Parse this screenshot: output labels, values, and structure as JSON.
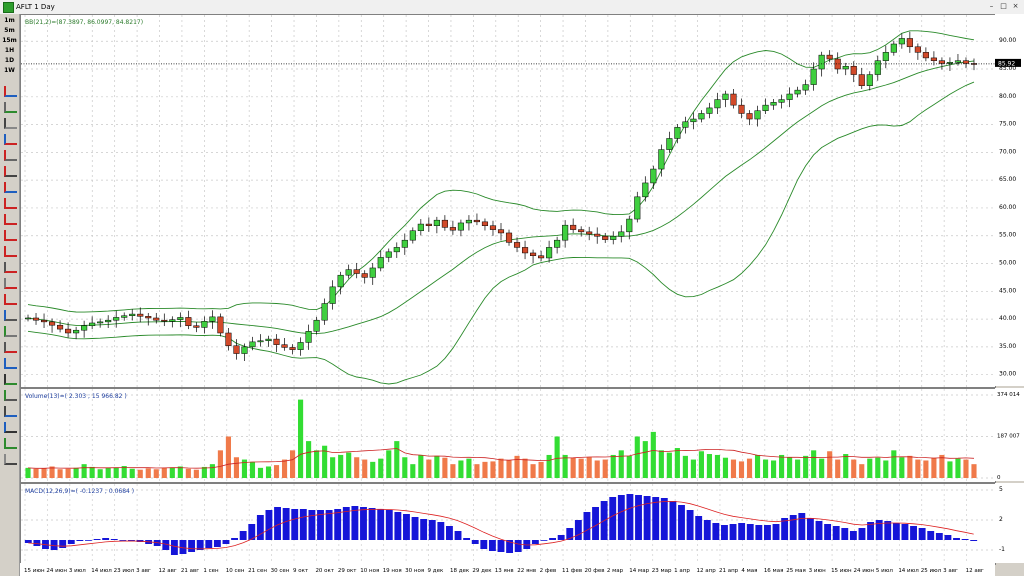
{
  "window": {
    "title": "AFLT 1 Day",
    "min_glyph": "–",
    "max_glyph": "□",
    "close_glyph": "×"
  },
  "timeframes": [
    "1m",
    "5m",
    "15m",
    "1H",
    "1D",
    "1W"
  ],
  "tools": [
    "cursor",
    "crosshair",
    "zoom-in",
    "zoom-out",
    "zoom-area",
    "line",
    "h-line",
    "v-line",
    "trend",
    "channel",
    "fib",
    "pencil",
    "text",
    "arrow",
    "ruler",
    "magnet",
    "delete",
    "lock",
    "layers",
    "grid",
    "settings",
    "bars",
    "candles",
    "volume"
  ],
  "price_panel": {
    "legend": "BB(21,2)=(87.3897, 86.0997, 84.8217)",
    "current_price_label": "85.92",
    "current_price": 85.92,
    "yticks": [
      "90.00",
      "85.00",
      "80.00",
      "75.00",
      "70.00",
      "65.00",
      "60.00",
      "55.00",
      "50.00",
      "45.00",
      "40.00",
      "35.00",
      "30.00"
    ]
  },
  "volume_panel": {
    "legend": "Volume(13)=( 2.303 ; 15 966.82 )",
    "yticks": [
      "374 014",
      "187 007",
      "0"
    ]
  },
  "macd_panel": {
    "legend": "MACD(12,26,9)=( -0.1237 ; 0.0684 )",
    "yticks": [
      "5",
      "2",
      "-1"
    ]
  },
  "x_labels": [
    "15 июн",
    "24 июн",
    "3 июл",
    "14 июл",
    "23 июл",
    "3 авг",
    "12 авг",
    "21 авг",
    "1 сен",
    "10 сен",
    "21 сен",
    "30 сен",
    "9 окт",
    "20 окт",
    "29 окт",
    "10 ноя",
    "19 ноя",
    "30 ноя",
    "9 дек",
    "18 дек",
    "29 дек",
    "13 янв",
    "22 янв",
    "2 фев",
    "11 фев",
    "20 фев",
    "2 мар",
    "14 мар",
    "23 мар",
    "1 апр",
    "12 апр",
    "21 апр",
    "4 мая",
    "16 мая",
    "25 мая",
    "3 июн",
    "15 июн",
    "24 июн",
    "5 июл",
    "14 июл",
    "25 июл",
    "3 авг",
    "12 авг"
  ],
  "chart_data": {
    "type": "candlestick",
    "close_series": [
      40.2,
      39.8,
      39.5,
      38.9,
      38.2,
      37.5,
      38.0,
      38.8,
      39.3,
      39.5,
      39.8,
      40.3,
      40.6,
      40.9,
      40.5,
      40.2,
      39.8,
      39.6,
      39.9,
      40.3,
      38.8,
      38.5,
      39.6,
      40.4,
      37.5,
      35.2,
      33.8,
      35.0,
      35.9,
      36.1,
      36.4,
      35.4,
      34.9,
      34.5,
      35.8,
      37.8,
      39.8,
      42.8,
      45.8,
      47.9,
      48.9,
      48.2,
      47.5,
      49.2,
      51.1,
      52.1,
      52.9,
      54.2,
      55.9,
      57.1,
      56.8,
      57.8,
      56.5,
      56.0,
      57.3,
      57.8,
      57.5,
      56.8,
      56.1,
      55.5,
      53.8,
      52.9,
      51.9,
      51.4,
      51.0,
      52.9,
      54.2,
      56.9,
      56.1,
      55.7,
      55.3,
      54.9,
      54.3,
      54.9,
      55.7,
      58.0,
      62.0,
      64.5,
      67.0,
      70.5,
      72.5,
      74.5,
      75.5,
      76.0,
      77.0,
      78.0,
      79.5,
      80.5,
      78.5,
      77.0,
      76.0,
      77.5,
      78.5,
      79.0,
      79.5,
      80.5,
      81.2,
      82.2,
      85.0,
      87.5,
      86.8,
      85.0,
      85.5,
      84.0,
      82.0,
      84.0,
      86.5,
      88.0,
      89.5,
      90.5,
      89.0,
      88.0,
      87.0,
      86.5,
      86.0,
      86.2,
      86.5,
      86.0,
      85.9
    ],
    "volume_series": [
      22,
      20,
      21,
      25,
      19,
      20,
      22,
      30,
      24,
      19,
      22,
      23,
      26,
      20,
      18,
      21,
      19,
      22,
      23,
      25,
      20,
      18,
      24,
      30,
      60,
      90,
      45,
      40,
      35,
      22,
      25,
      28,
      40,
      60,
      170,
      80,
      60,
      70,
      45,
      50,
      55,
      45,
      40,
      35,
      42,
      60,
      80,
      45,
      30,
      50,
      40,
      48,
      44,
      30,
      38,
      42,
      30,
      35,
      36,
      42,
      38,
      48,
      42,
      30,
      35,
      50,
      90,
      50,
      44,
      42,
      45,
      38,
      40,
      50,
      60,
      48,
      90,
      80,
      100,
      60,
      55,
      65,
      48,
      40,
      58,
      52,
      50,
      44,
      40,
      36,
      42,
      50,
      40,
      38,
      50,
      45,
      40,
      48,
      60,
      42,
      58,
      40,
      52,
      40,
      30,
      42,
      44,
      38,
      60,
      45,
      48,
      40,
      38,
      44,
      50,
      36,
      42,
      40,
      30
    ],
    "macd_series": [
      -0.3,
      -0.6,
      -0.9,
      -1.0,
      -0.8,
      -0.4,
      -0.1,
      0.0,
      0.1,
      0.2,
      0.1,
      0.0,
      -0.1,
      -0.2,
      -0.4,
      -0.6,
      -1.0,
      -1.5,
      -1.4,
      -1.2,
      -1.0,
      -0.8,
      -0.7,
      -0.4,
      0.2,
      0.9,
      1.6,
      2.5,
      3.0,
      3.3,
      3.2,
      3.1,
      3.1,
      3.0,
      3.0,
      3.0,
      3.1,
      3.3,
      3.4,
      3.3,
      3.2,
      3.1,
      3.0,
      2.8,
      2.6,
      2.3,
      2.1,
      2.0,
      1.8,
      1.4,
      0.9,
      0.2,
      -0.4,
      -0.9,
      -1.1,
      -1.2,
      -1.3,
      -1.2,
      -0.9,
      -0.4,
      0.0,
      0.2,
      0.5,
      1.2,
      2.0,
      2.8,
      3.3,
      3.9,
      4.3,
      4.5,
      4.6,
      4.5,
      4.4,
      4.3,
      4.2,
      3.9,
      3.5,
      3.0,
      2.4,
      2.0,
      1.7,
      1.5,
      1.6,
      1.7,
      1.6,
      1.5,
      1.5,
      1.6,
      2.2,
      2.5,
      2.7,
      2.2,
      1.9,
      1.6,
      1.4,
      1.2,
      0.9,
      1.2,
      1.8,
      2.0,
      1.9,
      1.7,
      1.6,
      1.4,
      1.2,
      0.9,
      0.7,
      0.5,
      0.2,
      0.1,
      -0.1
    ],
    "bb_upper_level": 87.3897,
    "bb_middle_level": 86.0997,
    "bb_lower_level": 84.8217
  }
}
